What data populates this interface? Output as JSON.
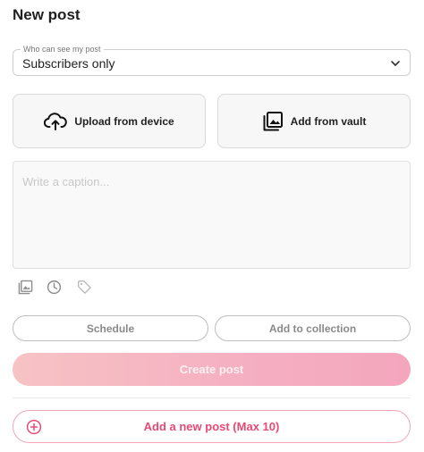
{
  "page": {
    "title": "New post"
  },
  "visibility": {
    "legend": "Who can see my post",
    "selected": "Subscribers only",
    "chevron_icon": "chevron-down-icon"
  },
  "upload": {
    "device_label": "Upload from device",
    "device_icon": "cloud-upload-icon",
    "vault_label": "Add from vault",
    "vault_icon": "image-gallery-icon"
  },
  "caption": {
    "placeholder": "Write a caption..."
  },
  "tools": [
    {
      "icon": "gallery-icon"
    },
    {
      "icon": "clock-icon"
    },
    {
      "icon": "tag-icon"
    }
  ],
  "actions": {
    "schedule_label": "Schedule",
    "collection_label": "Add to collection",
    "create_label": "Create post",
    "add_new_label": "Add a new post (Max 10)",
    "add_new_icon": "plus-circle-icon"
  },
  "colors": {
    "accent": "#e84a74",
    "create_gradient_start": "#f7c3c4",
    "create_gradient_end": "#f4a6bd"
  }
}
